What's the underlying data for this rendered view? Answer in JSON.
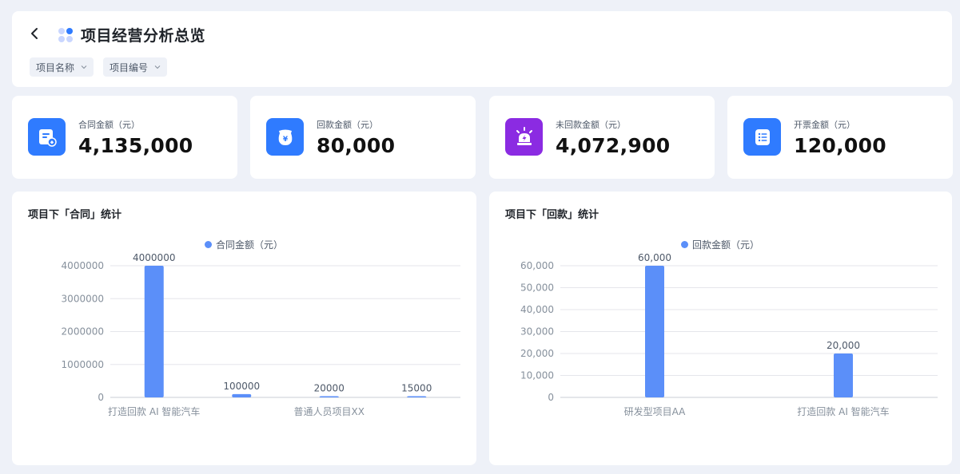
{
  "header": {
    "title": "项目经营分析总览",
    "filters": [
      {
        "label": "项目名称"
      },
      {
        "label": "项目编号"
      }
    ]
  },
  "stats": [
    {
      "label": "合同金额（元）",
      "value": "4,135,000",
      "icon": "contract-icon",
      "color": "#2f7bff"
    },
    {
      "label": "回款金额（元）",
      "value": "80,000",
      "icon": "money-bag-icon",
      "color": "#2f7bff"
    },
    {
      "label": "未回款金额（元）",
      "value": "4,072,900",
      "icon": "alarm-light-icon",
      "color": "#8b2be2"
    },
    {
      "label": "开票金额（元）",
      "value": "120,000",
      "icon": "invoice-list-icon",
      "color": "#2f7bff"
    }
  ],
  "colors": {
    "bar": "#5b8ff9",
    "accent": "#2f7bff",
    "purple": "#8b2be2"
  },
  "chart_data": [
    {
      "type": "bar",
      "title": "项目下「合同」统计",
      "series": [
        {
          "name": "合同金额（元）",
          "values": [
            4000000,
            100000,
            20000,
            15000
          ]
        }
      ],
      "categories": [
        "打造回款 AI 智能汽车",
        "",
        "普通人员项目XX",
        ""
      ],
      "data_labels": [
        "4000000",
        "100000",
        "20000",
        "15000"
      ],
      "y_ticks": [
        "0",
        "1000000",
        "2000000",
        "3000000",
        "4000000"
      ],
      "ylim": [
        0,
        4000000
      ],
      "grid": true,
      "legend": "top-center"
    },
    {
      "type": "bar",
      "title": "项目下「回款」统计",
      "series": [
        {
          "name": "回款金额（元）",
          "values": [
            60000,
            20000
          ]
        }
      ],
      "categories": [
        "研发型项目AA",
        "打造回款 AI 智能汽车"
      ],
      "data_labels": [
        "60,000",
        "20,000"
      ],
      "y_ticks": [
        "0",
        "10,000",
        "20,000",
        "30,000",
        "40,000",
        "50,000",
        "60,000"
      ],
      "ylim": [
        0,
        60000
      ],
      "grid": true,
      "legend": "top-center"
    }
  ]
}
